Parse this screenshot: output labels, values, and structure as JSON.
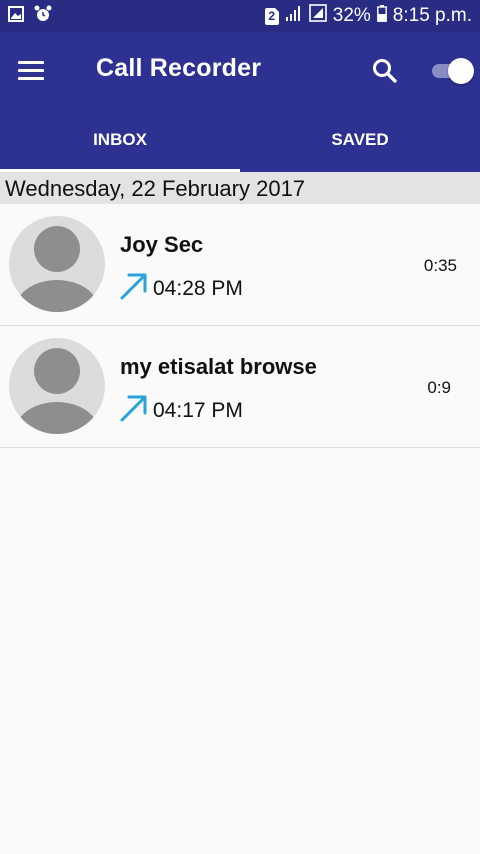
{
  "status_bar": {
    "sim_badge": "2",
    "battery": "32%",
    "time": "8:15 p.m.",
    "icons": [
      "gallery-icon",
      "alarm-icon",
      "sim-icon",
      "signal-icon",
      "data-icon",
      "battery-icon"
    ]
  },
  "app_bar": {
    "title": "Call Recorder",
    "icons": [
      "menu-icon",
      "search-icon",
      "recording-toggle"
    ],
    "toggle_on": true
  },
  "tabs": [
    {
      "label": "INBOX",
      "active": true
    },
    {
      "label": "SAVED",
      "active": false
    }
  ],
  "date_header": "Wednesday, 22 February 2017",
  "calls": [
    {
      "name": "Joy Sec",
      "time": "04:28 PM",
      "duration": "0:35",
      "direction": "outgoing",
      "direction_icon": "outgoing-call-arrow-icon"
    },
    {
      "name": "my etisalat browse",
      "time": "04:17 PM",
      "duration": "0:9",
      "direction": "outgoing",
      "direction_icon": "outgoing-call-arrow-icon"
    }
  ],
  "colors": {
    "status_bar": "#282d83",
    "app_bar": "#2d3191",
    "outgoing_arrow": "#29a3d9",
    "date_header_bg": "#e3e3e3"
  }
}
